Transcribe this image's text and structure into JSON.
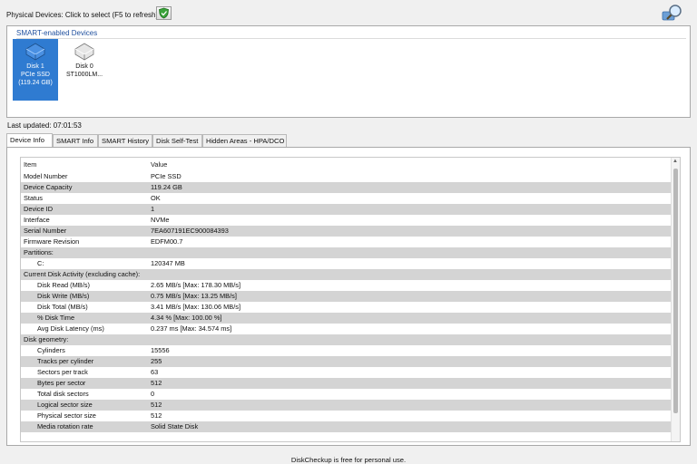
{
  "toolbar": {
    "physical_devices_label": "Physical Devices: Click to select (F5 to refresh)",
    "refresh_icon": "shield-refresh-icon",
    "search_icon": "magnifier-icon"
  },
  "devices": {
    "group_title": "SMART-enabled Devices",
    "items": [
      {
        "line1": "Disk 1",
        "line2": "PCIe SSD",
        "line3": "(119.24 GB)",
        "selected": true
      },
      {
        "line1": "Disk 0",
        "line2": "ST1000LM...",
        "line3": "",
        "selected": false
      }
    ]
  },
  "status": {
    "last_updated": "Last updated: 07:01:53"
  },
  "tabs": [
    {
      "label": "Device Info"
    },
    {
      "label": "SMART Info"
    },
    {
      "label": "SMART History"
    },
    {
      "label": "Disk Self-Test"
    },
    {
      "label": "Hidden Areas - HPA/DCO"
    }
  ],
  "table": {
    "headers": {
      "item": "Item",
      "value": "Value"
    },
    "rows": [
      {
        "item": "Model Number",
        "value": "PCIe SSD",
        "indent": false
      },
      {
        "item": "Device Capacity",
        "value": "119.24 GB",
        "indent": false
      },
      {
        "item": "Status",
        "value": "OK",
        "indent": false
      },
      {
        "item": "Device ID",
        "value": "1",
        "indent": false
      },
      {
        "item": "Interface",
        "value": "NVMe",
        "indent": false
      },
      {
        "item": "Serial Number",
        "value": "7EA607191EC900084393",
        "indent": false
      },
      {
        "item": "Firmware Revision",
        "value": "EDFM00.7",
        "indent": false
      },
      {
        "item": "Partitions:",
        "value": "",
        "indent": false
      },
      {
        "item": "C:",
        "value": "120347 MB",
        "indent": true
      },
      {
        "item": "Current Disk Activity (excluding cache):",
        "value": "",
        "indent": false
      },
      {
        "item": "Disk Read (MB/s)",
        "value": "2.65 MB/s [Max: 178.30 MB/s]",
        "indent": true
      },
      {
        "item": "Disk Write (MB/s)",
        "value": "0.75 MB/s [Max: 13.25 MB/s]",
        "indent": true
      },
      {
        "item": "Disk Total (MB/s)",
        "value": "3.41 MB/s [Max: 130.06 MB/s]",
        "indent": true
      },
      {
        "item": "% Disk Time",
        "value": "4.34 % [Max: 100.00 %]",
        "indent": true
      },
      {
        "item": "Avg Disk Latency (ms)",
        "value": "0.237 ms [Max: 34.574 ms]",
        "indent": true
      },
      {
        "item": "Disk geometry:",
        "value": "",
        "indent": false
      },
      {
        "item": "Cylinders",
        "value": "15556",
        "indent": true
      },
      {
        "item": "Tracks per cylinder",
        "value": "255",
        "indent": true
      },
      {
        "item": "Sectors per track",
        "value": "63",
        "indent": true
      },
      {
        "item": "Bytes per sector",
        "value": "512",
        "indent": true
      },
      {
        "item": "Total disk sectors",
        "value": "0",
        "indent": true
      },
      {
        "item": "Logical sector size",
        "value": "512",
        "indent": true
      },
      {
        "item": "Physical sector size",
        "value": "512",
        "indent": true
      },
      {
        "item": "Media rotation rate",
        "value": "Solid State Disk",
        "indent": true
      }
    ]
  },
  "footer": {
    "text": "DiskCheckup is free for personal use."
  },
  "colors": {
    "selection": "#2f7bd1",
    "shade": "#d4d4d4",
    "group_title": "#1f4f9e"
  }
}
